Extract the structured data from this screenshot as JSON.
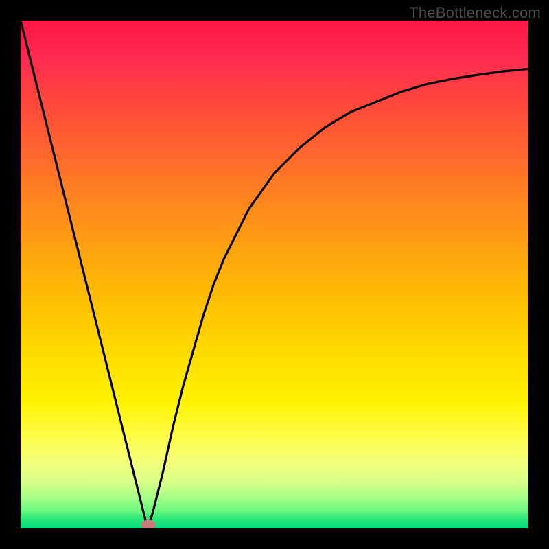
{
  "attribution": "TheBottleneck.com",
  "colors": {
    "frame": "#000000",
    "curve_stroke": "#000000",
    "marker_fill": "#c97a7a",
    "gradient_top": "#ff1744",
    "gradient_bottom": "#00db7a"
  },
  "chart_data": {
    "type": "line",
    "title": "",
    "xlabel": "",
    "ylabel": "",
    "xlim": [
      0,
      100
    ],
    "ylim": [
      0,
      100
    ],
    "notes": "V-shaped bottleneck curve over vertical rainbow gradient; minimum marked with oval.",
    "series": [
      {
        "name": "bottleneck-curve",
        "x": [
          0,
          2,
          4,
          6,
          8,
          10,
          12,
          14,
          16,
          18,
          20,
          22,
          24,
          25,
          26,
          28,
          30,
          32,
          34,
          36,
          38,
          40,
          42,
          45,
          50,
          55,
          60,
          65,
          70,
          75,
          80,
          85,
          90,
          95,
          100
        ],
        "y": [
          100,
          92,
          84,
          76,
          68,
          60,
          52,
          44,
          36,
          28,
          20,
          12,
          4,
          0,
          3,
          11,
          20,
          28,
          35,
          42,
          48,
          53,
          57,
          63,
          70,
          75,
          79,
          82,
          84,
          86,
          87.5,
          88.5,
          89.3,
          90,
          90.5
        ]
      }
    ],
    "marker": {
      "x": 25,
      "y": 0
    }
  }
}
